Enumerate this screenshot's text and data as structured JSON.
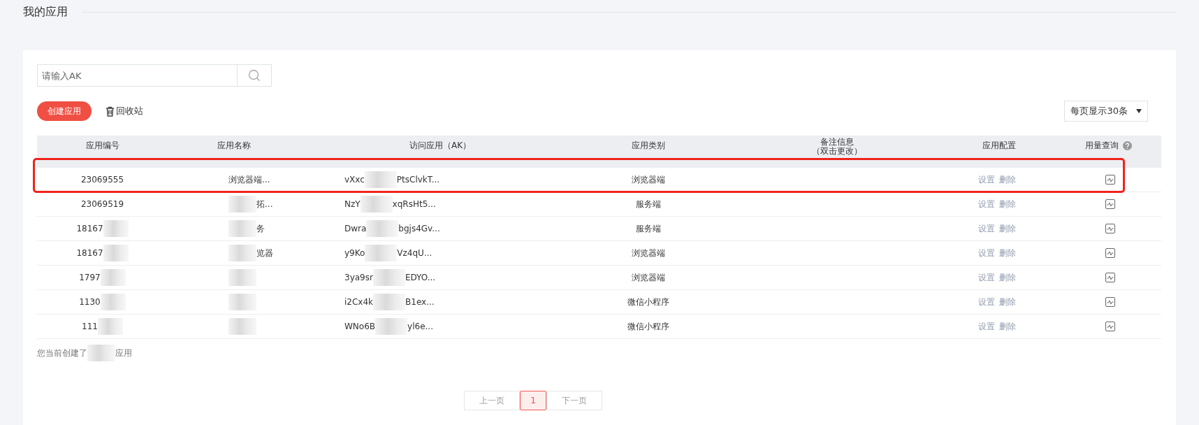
{
  "page_title": "我的应用",
  "search": {
    "placeholder": "请输入AK"
  },
  "create_button": "创建应用",
  "recycle_link": "回收站",
  "page_size_select": {
    "value": "每页显示30条"
  },
  "table": {
    "columns": [
      "应用编号",
      "应用名称",
      "访问应用（AK）",
      "应用类别",
      "备注信息",
      "应用配置",
      "用量查询"
    ],
    "column_note": "（双击更改）",
    "rows": [
      {
        "highlighted": true,
        "id": [
          {
            "text": "23069555"
          }
        ],
        "name": [
          {
            "text": "浏览器端..."
          }
        ],
        "ak": [
          {
            "text": "vXxc"
          },
          {
            "kind": "blur"
          },
          {
            "text": "PtsClvkT..."
          }
        ],
        "type": "浏览器端",
        "actions": [
          "设置",
          "删除"
        ]
      },
      {
        "highlighted": false,
        "id": [
          {
            "text": "23069519"
          }
        ],
        "name": [
          {
            "kind": "blur"
          },
          {
            "text": "拓..."
          }
        ],
        "ak": [
          {
            "text": "NzY"
          },
          {
            "kind": "blur"
          },
          {
            "text": "xqRsHt5..."
          }
        ],
        "type": "服务端",
        "actions": [
          "设置",
          "删除"
        ]
      },
      {
        "highlighted": false,
        "id": [
          {
            "text": "18167"
          },
          {
            "kind": "blur"
          }
        ],
        "name": [
          {
            "kind": "blur"
          },
          {
            "text": "务"
          }
        ],
        "ak": [
          {
            "text": "Dwra"
          },
          {
            "kind": "blur"
          },
          {
            "text": "bgjs4Gv..."
          }
        ],
        "type": "服务端",
        "actions": [
          "设置",
          "删除"
        ]
      },
      {
        "highlighted": false,
        "id": [
          {
            "text": "18167"
          },
          {
            "kind": "blur"
          }
        ],
        "name": [
          {
            "kind": "blur"
          },
          {
            "text": "览器"
          }
        ],
        "ak": [
          {
            "text": "y9Ko"
          },
          {
            "kind": "blur"
          },
          {
            "text": "Vz4qU..."
          }
        ],
        "type": "浏览器端",
        "actions": [
          "设置",
          "删除"
        ]
      },
      {
        "highlighted": false,
        "id": [
          {
            "text": "1797"
          },
          {
            "kind": "blur"
          }
        ],
        "name": [
          {
            "kind": "blur"
          }
        ],
        "ak": [
          {
            "text": "3ya9sr"
          },
          {
            "kind": "blur"
          },
          {
            "text": "EDYO..."
          }
        ],
        "type": "浏览器端",
        "actions": [
          "设置",
          "删除"
        ]
      },
      {
        "highlighted": false,
        "id": [
          {
            "text": "1130"
          },
          {
            "kind": "blur"
          }
        ],
        "name": [
          {
            "kind": "blur"
          }
        ],
        "ak": [
          {
            "text": "i2Cx4k"
          },
          {
            "kind": "blur"
          },
          {
            "text": "B1ex..."
          }
        ],
        "type": "微信小程序",
        "actions": [
          "设置",
          "删除"
        ]
      },
      {
        "highlighted": false,
        "id": [
          {
            "text": "111"
          },
          {
            "kind": "blur"
          }
        ],
        "name": [
          {
            "kind": "blur"
          }
        ],
        "ak": [
          {
            "text": "WNo6B"
          },
          {
            "kind": "blur"
          },
          {
            "text": "yl6e..."
          }
        ],
        "type": "微信小程序",
        "actions": [
          "设置",
          "删除"
        ]
      }
    ]
  },
  "summary": [
    {
      "text": "您当前创建了"
    },
    {
      "kind": "blur"
    },
    {
      "text": "应用"
    }
  ],
  "pagination": [
    {
      "label": "上一页",
      "selected": false
    },
    {
      "label": "1",
      "selected": true
    },
    {
      "label": "下一页",
      "selected": false
    }
  ]
}
